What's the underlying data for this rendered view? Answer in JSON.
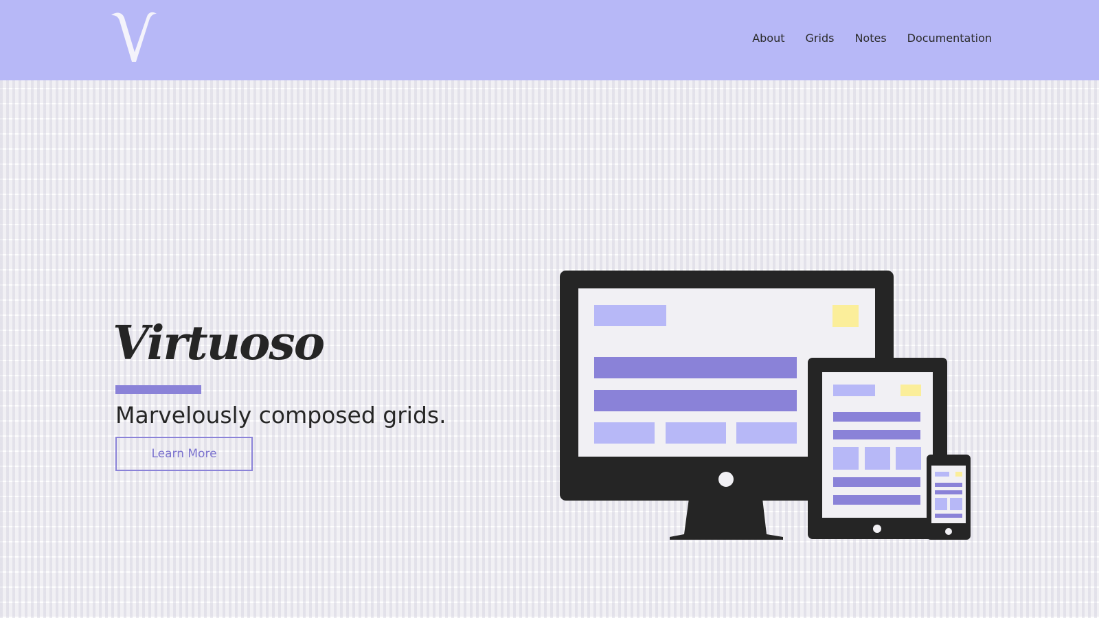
{
  "header": {
    "logo_letter": "V",
    "nav": [
      {
        "label": "About"
      },
      {
        "label": "Grids"
      },
      {
        "label": "Notes"
      },
      {
        "label": "Documentation"
      }
    ]
  },
  "hero": {
    "title": "Virtuoso",
    "tagline": "Marvelously composed grids.",
    "cta_label": "Learn More"
  },
  "colors": {
    "header_bg": "#b7b8f7",
    "accent": "#8a82d8",
    "light_block": "#b7b8f7",
    "yellow_block": "#fbee9a",
    "device_dark": "#252525",
    "screen_bg": "#f1f0f4"
  },
  "illustration": {
    "devices": [
      "desktop-monitor",
      "tablet",
      "smartphone"
    ]
  }
}
